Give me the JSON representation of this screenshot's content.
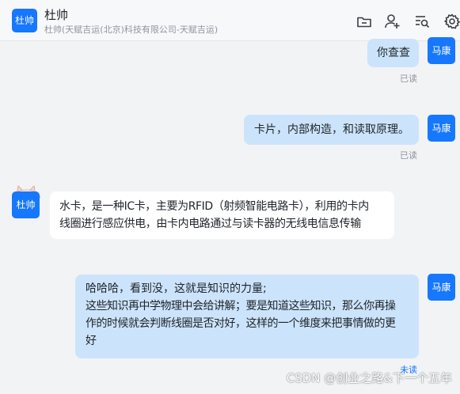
{
  "header": {
    "avatar_text": "杜帅",
    "title": "杜帅",
    "subtitle": "杜帅(天赋吉运(北京)科技有限公司-天赋吉运)",
    "icons": [
      "folder-icon",
      "add-user-icon",
      "search-list-icon",
      "settings-icon"
    ]
  },
  "messages": [
    {
      "sender": "马康",
      "side": "right",
      "text": "你查查",
      "status": "已读"
    },
    {
      "sender": "马康",
      "side": "right",
      "text": "卡片，内部构造，和读取原理。",
      "status": "已读"
    },
    {
      "sender": "杜帅",
      "side": "left",
      "lines": [
        "水卡，是一种IC卡，主要为RFID（射频智能电路卡），利用的卡内",
        "线圈进行感应供电，由卡内电路通过与读卡器的无线电信息传输"
      ]
    },
    {
      "sender": "马康",
      "side": "right",
      "lines": [
        "哈哈哈，看到没，这就是知识的力量;",
        "这些知识再中学物理中会给讲解；要是知道这些知识，那么你再操",
        "作的时候就会判断线圈是否对好，这样的一个维度来把事情做的更",
        "好"
      ],
      "status": "未读"
    }
  ],
  "watermark": "CSDN @创业之路&下一个五年",
  "colors": {
    "accent": "#1677ff",
    "my_bubble": "#cce4fb",
    "their_bubble": "#ffffff",
    "background": "#f2f3f5"
  }
}
